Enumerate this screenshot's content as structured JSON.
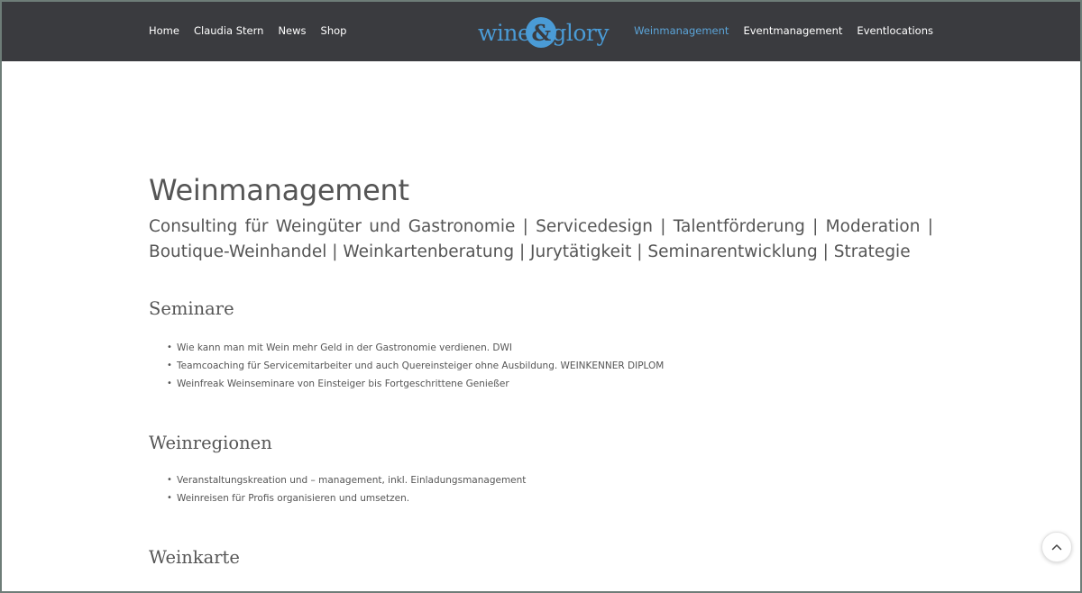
{
  "header": {
    "nav_left": [
      {
        "label": "Home"
      },
      {
        "label": "Claudia Stern"
      },
      {
        "label": "News"
      },
      {
        "label": "Shop"
      }
    ],
    "logo": {
      "part1": "wine",
      "amp": "&",
      "part2": "glory"
    },
    "nav_right": [
      {
        "label": "Weinmanagement",
        "active": true
      },
      {
        "label": "Eventmanagement"
      },
      {
        "label": "Eventlocations"
      }
    ],
    "background": "#3a3b3f",
    "active_color": "#5ba4d8"
  },
  "main": {
    "title": "Weinmanagement",
    "subtitle": "Consulting für Weingüter und Gastronomie | Servicedesign | Talentförderung | Moderation | Boutique-Weinhandel | Weinkartenberatung | Jurytätigkeit | Seminarentwicklung | Strategie",
    "sections": [
      {
        "heading": "Seminare",
        "items": [
          "Wie kann man mit Wein mehr Geld in der Gastronomie verdienen. DWI",
          "Teamcoaching für Servicemitarbeiter und auch Quereinsteiger ohne Ausbildung. WEINKENNER DIPLOM",
          "Weinfreak Weinseminare von Einsteiger bis Fortgeschrittene Genießer"
        ]
      },
      {
        "heading": "Weinregionen",
        "items": [
          "Veranstaltungskreation und – management, inkl. Einladungsmanagement",
          "Weinreisen für Profis organisieren und umsetzen."
        ]
      },
      {
        "heading": "Weinkarte",
        "items": []
      }
    ]
  },
  "scroll_top": {
    "icon": "chevron-up-icon"
  }
}
